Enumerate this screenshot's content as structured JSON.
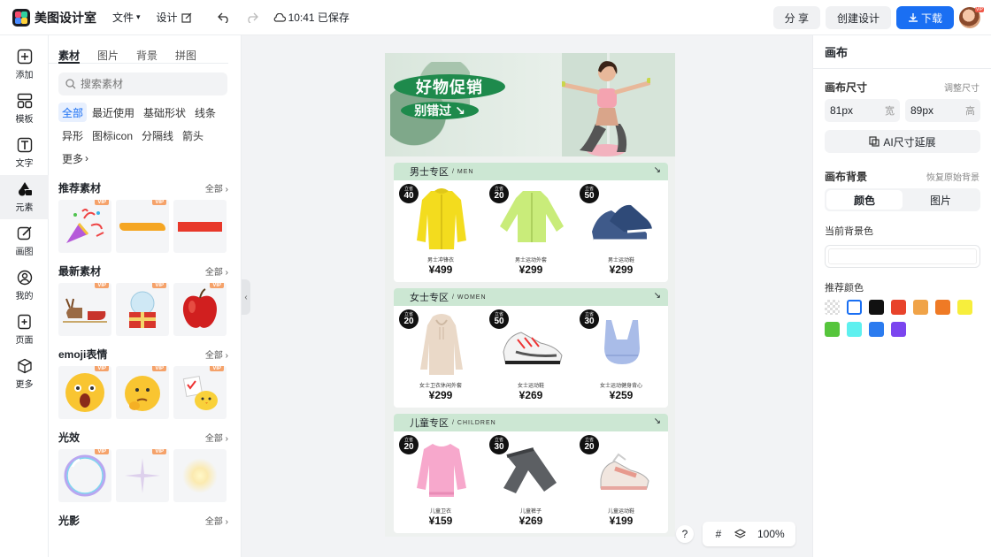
{
  "app": {
    "name": "美图设计室"
  },
  "topbar": {
    "menu_file": "文件",
    "menu_design": "设计",
    "save_status": "10:41 已保存",
    "share": "分 享",
    "create": "创建设计",
    "download": "下载",
    "avatar_badge": "VIP"
  },
  "leftnav": [
    {
      "label": "添加",
      "icon": "plus-square-icon"
    },
    {
      "label": "模板",
      "icon": "template-icon"
    },
    {
      "label": "文字",
      "icon": "text-icon"
    },
    {
      "label": "元素",
      "icon": "shapes-icon",
      "active": true
    },
    {
      "label": "画图",
      "icon": "draw-icon"
    },
    {
      "label": "我的",
      "icon": "user-icon"
    },
    {
      "label": "页面",
      "icon": "page-add-icon"
    },
    {
      "label": "更多",
      "icon": "cube-icon"
    }
  ],
  "panel": {
    "tabs": [
      "素材",
      "图片",
      "背景",
      "拼图"
    ],
    "search_placeholder": "搜索素材",
    "chips": [
      "全部",
      "最近使用",
      "基础形状",
      "线条",
      "异形",
      "图标icon",
      "分隔线",
      "箭头",
      "更多"
    ],
    "all_label": "全部",
    "vip": "VIP",
    "sections": [
      {
        "title": "推荐素材",
        "items": [
          "party-popper",
          "brush-stroke",
          "red-bar"
        ]
      },
      {
        "title": "最新素材",
        "items": [
          "reindeer-sleigh",
          "snow-globe-gift",
          "apple"
        ]
      },
      {
        "title": "emoji表情",
        "items": [
          "scared-emoji",
          "thinking-emoji",
          "chick-emoji"
        ]
      },
      {
        "title": "光效",
        "items": [
          "bubble",
          "sparkle",
          "glow"
        ]
      },
      {
        "title": "光影",
        "items": []
      }
    ]
  },
  "canvas": {
    "banner_title": "好物促销",
    "banner_sub": "别错过 ↘",
    "sections": [
      {
        "title": "男士专区",
        "en": "/ MEN",
        "products": [
          {
            "badge_top": "立省",
            "badge_num": "40",
            "name": "男士冲锋衣",
            "price": "¥499",
            "kind": "yellow-jacket"
          },
          {
            "badge_top": "立省",
            "badge_num": "20",
            "name": "男士运动外套",
            "price": "¥299",
            "kind": "green-jacket"
          },
          {
            "badge_top": "立省",
            "badge_num": "50",
            "name": "男士运动鞋",
            "price": "¥299",
            "kind": "blue-shoes"
          }
        ]
      },
      {
        "title": "女士专区",
        "en": "/ WOMEN",
        "products": [
          {
            "badge_top": "立省",
            "badge_num": "20",
            "name": "女士卫衣休闲外套",
            "price": "¥299",
            "kind": "beige-hoodie"
          },
          {
            "badge_top": "立省",
            "badge_num": "50",
            "name": "女士运动鞋",
            "price": "¥269",
            "kind": "white-shoes"
          },
          {
            "badge_top": "立省",
            "badge_num": "30",
            "name": "女士运动健身背心",
            "price": "¥259",
            "kind": "blue-bra"
          }
        ]
      },
      {
        "title": "儿童专区",
        "en": "/ CHILDREN",
        "products": [
          {
            "badge_top": "立省",
            "badge_num": "20",
            "name": "儿童卫衣",
            "price": "¥159",
            "kind": "pink-sweater"
          },
          {
            "badge_top": "立省",
            "badge_num": "30",
            "name": "儿童裤子",
            "price": "¥269",
            "kind": "grey-pants"
          },
          {
            "badge_top": "立省",
            "badge_num": "20",
            "name": "儿童运动鞋",
            "price": "¥199",
            "kind": "kids-shoes"
          }
        ]
      }
    ]
  },
  "rightpanel": {
    "title": "画布",
    "size_label": "画布尺寸",
    "size_adjust": "调整尺寸",
    "width_value": "81px",
    "width_unit": "宽",
    "height_value": "89px",
    "height_unit": "高",
    "ai_extend": "AI尺寸延展",
    "bg_label": "画布背景",
    "bg_restore": "恢复原始背景",
    "seg_color": "颜色",
    "seg_image": "图片",
    "current_bg": "当前背景色",
    "recommend": "推荐颜色",
    "swatches": [
      "transparent",
      "#ffffff",
      "#111111",
      "#e8432b",
      "#f0a348",
      "#ef7a25",
      "#f7ee3c",
      "#56c53c",
      "#5ef0ef",
      "#2b7bef",
      "#7b45ef"
    ]
  },
  "bottom": {
    "help": "?",
    "zoom": "100%"
  }
}
